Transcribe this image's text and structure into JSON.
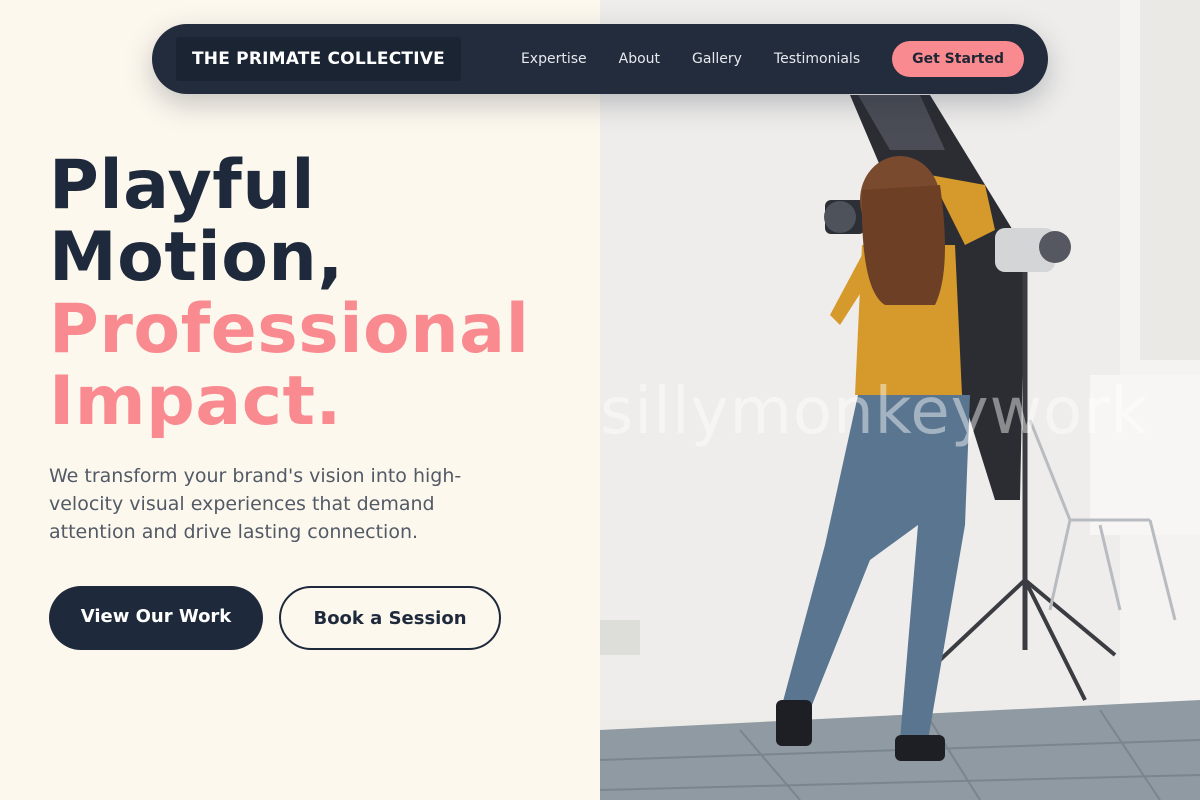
{
  "nav": {
    "brand": "THE PRIMATE COLLECTIVE",
    "links": [
      "Expertise",
      "About",
      "Gallery",
      "Testimonials"
    ],
    "cta": "Get Started"
  },
  "hero": {
    "title_line1": "Playful",
    "title_line2": "Motion,",
    "title_line3": "Professional",
    "title_line4": "Impact.",
    "description": "We transform your brand's vision into high-velocity visual experiences that demand attention and drive lasting connection.",
    "primary_button": "View Our Work",
    "secondary_button": "Book a Session"
  },
  "image": {
    "watermark": "sillymonkeywork",
    "icon": "photographer-photo"
  },
  "colors": {
    "navy": "#1e2a3c",
    "accent": "#f98a90",
    "background": "#fdf8ee"
  }
}
